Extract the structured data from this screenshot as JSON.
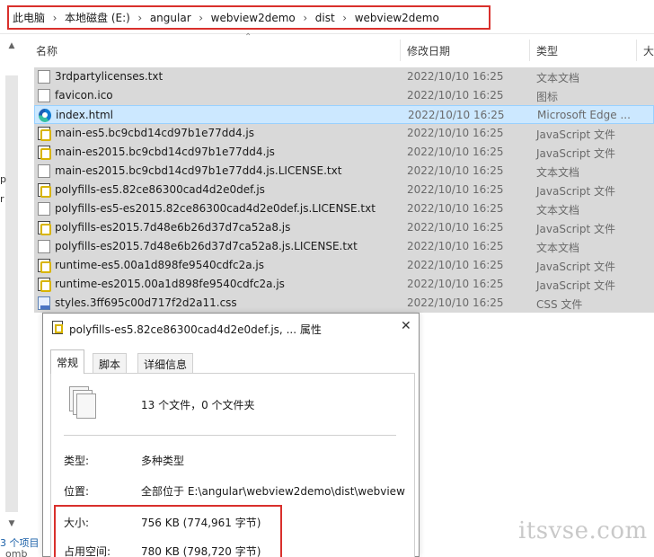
{
  "breadcrumb": [
    "此电脑",
    "本地磁盘 (E:)",
    "angular",
    "webview2demo",
    "dist",
    "webview2demo"
  ],
  "left_fragments": [
    "p",
    "r"
  ],
  "status_text": "3 个项目",
  "status_text_2": "omb",
  "columns": {
    "name": "名称",
    "date": "修改日期",
    "type": "类型",
    "size": "大"
  },
  "files": [
    {
      "name": "3rdpartylicenses.txt",
      "date": "2022/10/10 16:25",
      "type": "文本文档",
      "icon": "text-file-icon"
    },
    {
      "name": "favicon.ico",
      "date": "2022/10/10 16:25",
      "type": "图标",
      "icon": "icon-file-icon"
    },
    {
      "name": "index.html",
      "date": "2022/10/10 16:25",
      "type": "Microsoft Edge ...",
      "icon": "edge-html-icon"
    },
    {
      "name": "main-es5.bc9cbd14cd97b1e77dd4.js",
      "date": "2022/10/10 16:25",
      "type": "JavaScript 文件",
      "icon": "javascript-file-icon"
    },
    {
      "name": "main-es2015.bc9cbd14cd97b1e77dd4.js",
      "date": "2022/10/10 16:25",
      "type": "JavaScript 文件",
      "icon": "javascript-file-icon"
    },
    {
      "name": "main-es2015.bc9cbd14cd97b1e77dd4.js.LICENSE.txt",
      "date": "2022/10/10 16:25",
      "type": "文本文档",
      "icon": "text-file-icon"
    },
    {
      "name": "polyfills-es5.82ce86300cad4d2e0def.js",
      "date": "2022/10/10 16:25",
      "type": "JavaScript 文件",
      "icon": "javascript-file-icon"
    },
    {
      "name": "polyfills-es5-es2015.82ce86300cad4d2e0def.js.LICENSE.txt",
      "date": "2022/10/10 16:25",
      "type": "文本文档",
      "icon": "text-file-icon"
    },
    {
      "name": "polyfills-es2015.7d48e6b26d37d7ca52a8.js",
      "date": "2022/10/10 16:25",
      "type": "JavaScript 文件",
      "icon": "javascript-file-icon"
    },
    {
      "name": "polyfills-es2015.7d48e6b26d37d7ca52a8.js.LICENSE.txt",
      "date": "2022/10/10 16:25",
      "type": "文本文档",
      "icon": "text-file-icon"
    },
    {
      "name": "runtime-es5.00a1d898fe9540cdfc2a.js",
      "date": "2022/10/10 16:25",
      "type": "JavaScript 文件",
      "icon": "javascript-file-icon"
    },
    {
      "name": "runtime-es2015.00a1d898fe9540cdfc2a.js",
      "date": "2022/10/10 16:25",
      "type": "JavaScript 文件",
      "icon": "javascript-file-icon"
    },
    {
      "name": "styles.3ff695c00d717f2d2a11.css",
      "date": "2022/10/10 16:25",
      "type": "CSS 文件",
      "icon": "css-file-icon"
    }
  ],
  "dialog": {
    "title": "polyfills-es5.82ce86300cad4d2e0def.js, ... 属性",
    "close_glyph": "✕",
    "tabs": [
      "常规",
      "脚本",
      "详细信息"
    ],
    "count": "13 个文件，0 个文件夹",
    "type_label": "类型:",
    "type_value": "多种类型",
    "location_label": "位置:",
    "location_value": "全部位于 E:\\angular\\webview2demo\\dist\\webview",
    "size_label": "大小:",
    "size_value": "756 KB (774,961 字节)",
    "disk_label": "占用空间:",
    "disk_value": "780 KB (798,720 字节)"
  },
  "watermark": "itsvse.com",
  "colors": {
    "selection": "#cce8ff",
    "highlight_box": "#d9302c",
    "row_bg": "#d9d9d9"
  }
}
